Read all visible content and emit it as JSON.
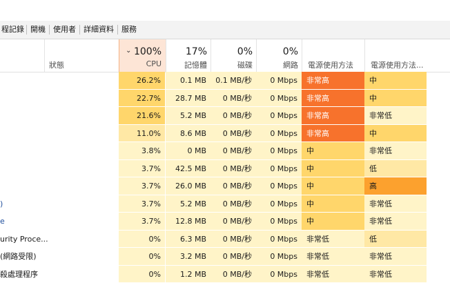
{
  "tabs": [
    "程記錄",
    "開機",
    "使用者",
    "詳細資料",
    "服務"
  ],
  "header": {
    "status_label": "狀態",
    "cpu": {
      "pct": "100%",
      "label": "CPU",
      "sort_arrow": "⌄"
    },
    "memory": {
      "pct": "17%",
      "label": "記憶體"
    },
    "disk": {
      "pct": "0%",
      "label": "磁碟"
    },
    "network": {
      "pct": "0%",
      "label": "網路"
    },
    "power": {
      "label": "電源使用方法"
    },
    "power_trend": {
      "label": "電源使用方法..."
    }
  },
  "colors": {
    "heat": {
      "very_light": "#fff4c8",
      "light": "#ffe8a5",
      "mid": "#ffd66b",
      "high": "#fc9d5c",
      "very_high": "#f7722c"
    },
    "cpu_column_bg": "#fde5d6",
    "link_text": "#1f4e9c"
  },
  "rows": [
    {
      "name": "",
      "cpu": "26.2%",
      "mem": "0.1 MB",
      "disk": "0.1 MB/秒",
      "net": "0 Mbps",
      "power": "非常高",
      "trend": "中"
    },
    {
      "name": "",
      "cpu": "22.7%",
      "mem": "28.7 MB",
      "disk": "0 MB/秒",
      "net": "0 Mbps",
      "power": "非常高",
      "trend": "中"
    },
    {
      "name": "",
      "cpu": "21.6%",
      "mem": "5.2 MB",
      "disk": "0 MB/秒",
      "net": "0 Mbps",
      "power": "非常高",
      "trend": "非常低"
    },
    {
      "name": "",
      "cpu": "11.0%",
      "mem": "8.6 MB",
      "disk": "0 MB/秒",
      "net": "0 Mbps",
      "power": "非常高",
      "trend": "中"
    },
    {
      "name": "",
      "cpu": "3.8%",
      "mem": "0 MB",
      "disk": "0 MB/秒",
      "net": "0 Mbps",
      "power": "中",
      "trend": "非常低"
    },
    {
      "name": "",
      "cpu": "3.7%",
      "mem": "42.5 MB",
      "disk": "0 MB/秒",
      "net": "0 Mbps",
      "power": "中",
      "trend": "低"
    },
    {
      "name": "",
      "cpu": "3.7%",
      "mem": "26.0 MB",
      "disk": "0 MB/秒",
      "net": "0 Mbps",
      "power": "中",
      "trend": "高"
    },
    {
      "name": ")",
      "cpu": "3.7%",
      "mem": "5.2 MB",
      "disk": "0 MB/秒",
      "net": "0 Mbps",
      "power": "中",
      "trend": "非常低"
    },
    {
      "name": "e",
      "cpu": "3.7%",
      "mem": "12.8 MB",
      "disk": "0 MB/秒",
      "net": "0 Mbps",
      "power": "中",
      "trend": "非常低"
    },
    {
      "name": "urity Proce...",
      "cpu": "0%",
      "mem": "6.3 MB",
      "disk": "0 MB/秒",
      "net": "0 Mbps",
      "power": "非常低",
      "trend": "低"
    },
    {
      "name": "(網路受限)",
      "cpu": "0%",
      "mem": "3.2 MB",
      "disk": "0 MB/秒",
      "net": "0 Mbps",
      "power": "非常低",
      "trend": "非常低"
    },
    {
      "name": "殺處理程序",
      "cpu": "0%",
      "mem": "1.2 MB",
      "disk": "0 MB/秒",
      "net": "0 Mbps",
      "power": "非常低",
      "trend": "非常低"
    }
  ]
}
